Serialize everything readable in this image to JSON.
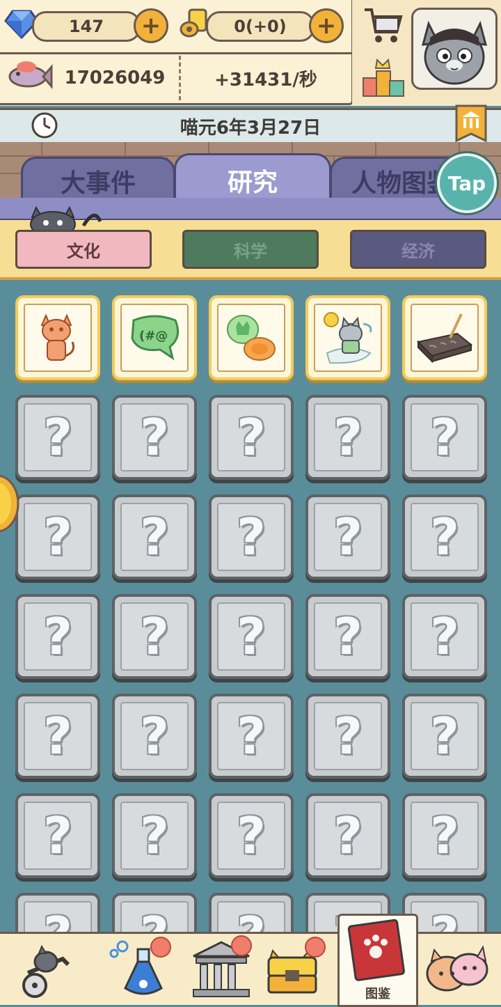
{
  "resources": {
    "gems": "147",
    "scrolls": "0(+0)",
    "fish_total": "17026049",
    "fish_rate": "+31431/秒"
  },
  "date": "喵元6年3月27日",
  "tabs": [
    {
      "label": "大事件",
      "active": false
    },
    {
      "label": "研究",
      "active": true
    },
    {
      "label": "人物图鉴",
      "active": false
    }
  ],
  "tap_label": "Tap",
  "categories": [
    {
      "label": "文化",
      "color": "#f2b8c0",
      "text_color": "#5b3a3f",
      "active": true
    },
    {
      "label": "科学",
      "color": "#4e7b5e",
      "text_color": "#7aa28a",
      "active": false
    },
    {
      "label": "经济",
      "color": "#5a5a80",
      "text_color": "#8a86b0",
      "active": false
    }
  ],
  "grid": {
    "unlocked_icons": [
      "cat-statue-icon",
      "speech-bubble-icon",
      "cat-faces-icon",
      "cat-sage-icon",
      "stone-tablet-icon"
    ],
    "locked_symbol": "?"
  },
  "bottom_nav": {
    "active_label": "图鉴",
    "items": [
      "cart-cat-icon",
      "potion-icon",
      "temple-icon",
      "treasure-chest-icon",
      "codex-book-icon",
      "cat-friends-icon"
    ]
  },
  "colors": {
    "accent": "#f2b23a",
    "background": "#5a8d9a",
    "locked_tile": "#c8ccce",
    "unlocked_border": "#f4cb5a"
  }
}
